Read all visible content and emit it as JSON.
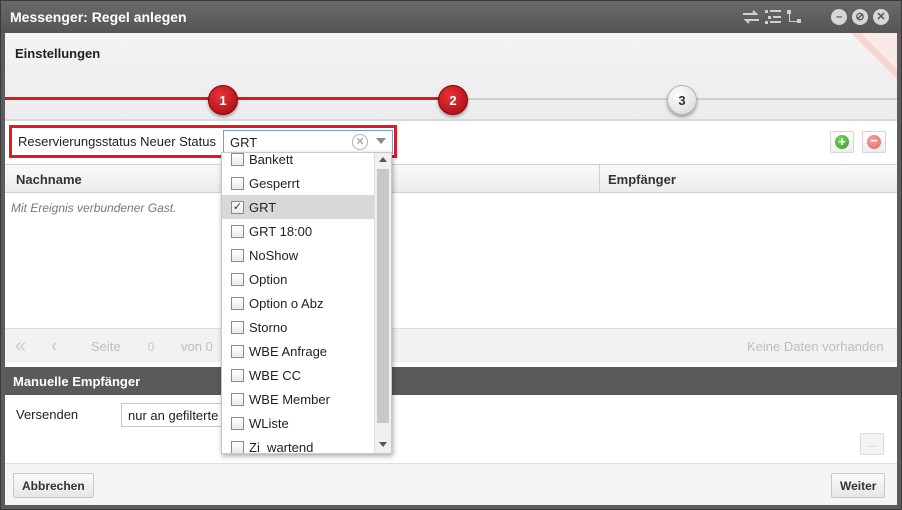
{
  "window": {
    "title": "Messenger: Regel anlegen",
    "icons": [
      "swap-icon",
      "tree-expand-icon",
      "tree-collapse-icon",
      "minimize-icon",
      "maximize-icon",
      "close-icon"
    ]
  },
  "wizard": {
    "title": "Einstellungen",
    "steps": [
      {
        "label": "1",
        "state": "active"
      },
      {
        "label": "2",
        "state": "active"
      },
      {
        "label": "3",
        "state": "inactive"
      }
    ],
    "accent_color": "#d71920"
  },
  "filter": {
    "label": "Reservierungsstatus Neuer Status",
    "value": "GRT"
  },
  "grid": {
    "columns": [
      "Nachname",
      "Empfänger"
    ],
    "empty_text": "Mit Ereignis verbundener Gast."
  },
  "pager": {
    "page_label": "Seite",
    "page_value": "0",
    "of_label": "von 0",
    "no_data": "Keine Daten vorhanden"
  },
  "manual_recipients": {
    "title": "Manuelle Empfänger",
    "send_label": "Versenden",
    "send_value": "nur an gefilterte",
    "more_label": "..."
  },
  "footer": {
    "cancel_label": "Abbrechen",
    "next_label": "Weiter"
  },
  "dropdown": {
    "items": [
      {
        "label": "Bankett",
        "checked": false
      },
      {
        "label": "Gesperrt",
        "checked": false
      },
      {
        "label": "GRT",
        "checked": true
      },
      {
        "label": "GRT 18:00",
        "checked": false
      },
      {
        "label": "NoShow",
        "checked": false
      },
      {
        "label": "Option",
        "checked": false
      },
      {
        "label": "Option o Abz",
        "checked": false
      },
      {
        "label": "Storno",
        "checked": false
      },
      {
        "label": "WBE Anfrage",
        "checked": false
      },
      {
        "label": "WBE CC",
        "checked": false
      },
      {
        "label": "WBE Member",
        "checked": false
      },
      {
        "label": "WListe",
        "checked": false
      },
      {
        "label": "Zi_wartend",
        "checked": false
      }
    ]
  }
}
